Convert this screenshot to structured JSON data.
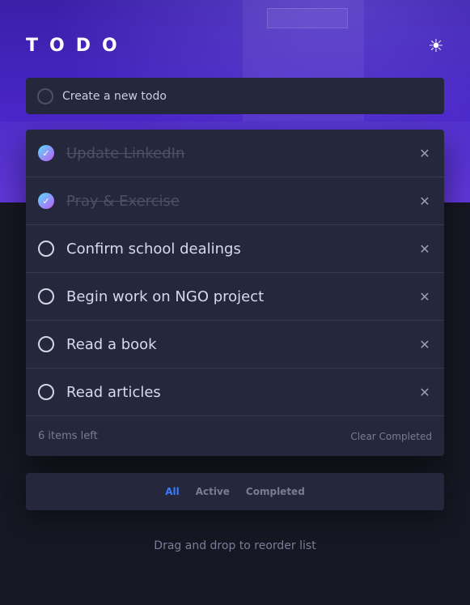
{
  "header": {
    "title": "TODO",
    "theme_icon": "sun-icon"
  },
  "new_todo": {
    "placeholder": "Create a new todo"
  },
  "todos": [
    {
      "text": "Update LinkedIn",
      "completed": true
    },
    {
      "text": "Pray & Exercise",
      "completed": true
    },
    {
      "text": "Confirm school dealings",
      "completed": false
    },
    {
      "text": "Begin work on NGO project",
      "completed": false
    },
    {
      "text": "Read a book",
      "completed": false
    },
    {
      "text": "Read articles",
      "completed": false
    }
  ],
  "footer": {
    "items_left": "6 items left",
    "clear_completed": "Clear Completed"
  },
  "filters": {
    "all": "All",
    "active": "Active",
    "completed": "Completed",
    "selected": "All"
  },
  "hint": "Drag and drop to reorder list",
  "colors": {
    "accent": "#3a7bfd",
    "check_gradient_start": "#57ddff",
    "check_gradient_end": "#c058f3",
    "card": "#25273c",
    "background": "#171723"
  },
  "icons": {
    "delete": "close-icon",
    "check": "check-icon"
  }
}
